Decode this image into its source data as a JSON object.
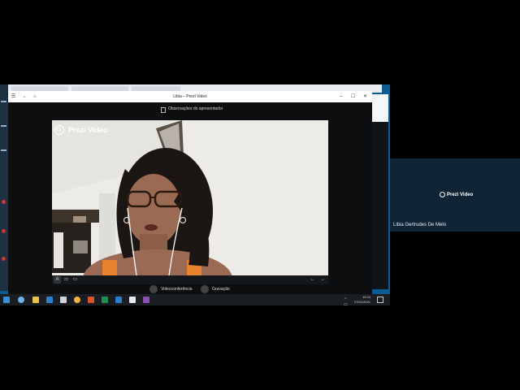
{
  "shared_screen": {
    "window_title": "Libia – Prezi Video",
    "toolbar": {
      "presenter_notes_label": "Observações do apresentador"
    },
    "video": {
      "logo_text": "Prezi Video"
    },
    "bottom_bar": {
      "videoconference_label": "Videoconferência",
      "recording_label": "Gravação"
    },
    "taskbar": {
      "time": "19:24",
      "date": "27/01/2021"
    }
  },
  "participant_tile": {
    "logo_text": "Prezi Video",
    "name": "Libia Gertrudes De Melo"
  },
  "colors": {
    "desktop_blue": "#0c5c93",
    "tile_bg": "#0f2536",
    "accent_taskbar_app": "#8a4fb3"
  }
}
